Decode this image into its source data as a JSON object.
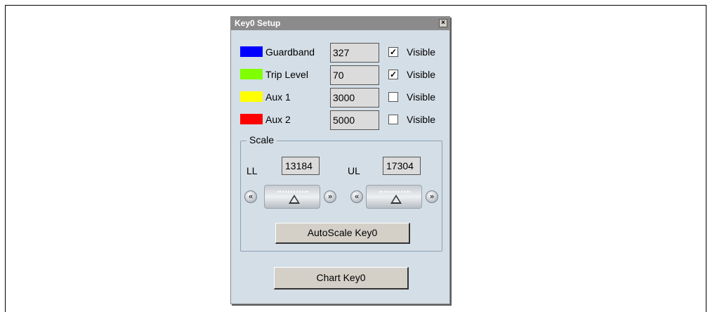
{
  "dialog": {
    "title": "Key0 Setup",
    "close_glyph": "×"
  },
  "levels": [
    {
      "label": "Guardband",
      "value": "327",
      "visible": true,
      "color": "#0000ff",
      "visible_label": "Visible"
    },
    {
      "label": "Trip Level",
      "value": "70",
      "visible": true,
      "color": "#80ff00",
      "visible_label": "Visible"
    },
    {
      "label": "Aux 1",
      "value": "3000",
      "visible": false,
      "color": "#ffff00",
      "visible_label": "Visible"
    },
    {
      "label": "Aux 2",
      "value": "5000",
      "visible": false,
      "color": "#ff0000",
      "visible_label": "Visible"
    }
  ],
  "check_glyph": "✓",
  "scale": {
    "title": "Scale",
    "ll_label": "LL",
    "ll_value": "13184",
    "ul_label": "UL",
    "ul_value": "17304",
    "left_arrow_glyph": "«",
    "right_arrow_glyph": "»",
    "autoscale_label": "AutoScale Key0"
  },
  "chart_button_label": "Chart Key0"
}
